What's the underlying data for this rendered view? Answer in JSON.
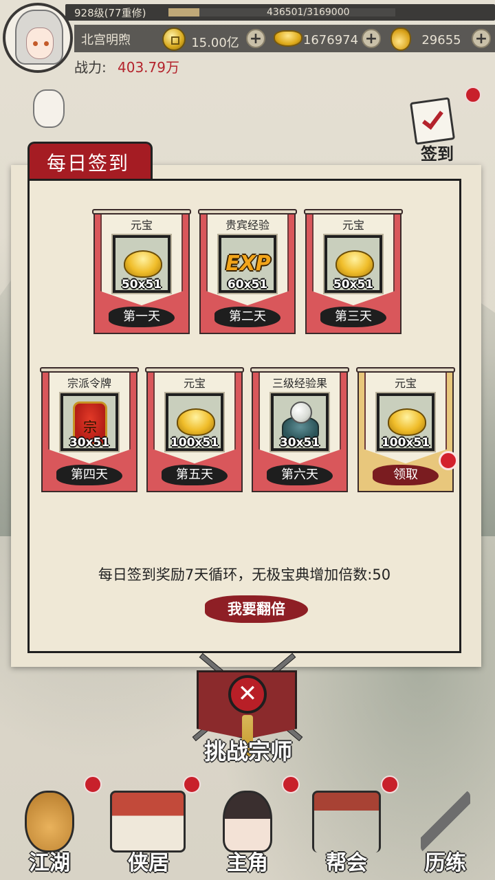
{
  "player": {
    "level_text": "928级(77重修)",
    "xp_text": "436501/3169000",
    "xp_progress": 0.1377,
    "name": "北宫明煦",
    "power_label": "战力:",
    "power_value": "403.79万"
  },
  "resources": [
    {
      "icon": "copper-coin-icon",
      "value": "15.00亿",
      "plus": "+"
    },
    {
      "icon": "gold-ingot-icon",
      "value": "1676974",
      "plus": "+"
    },
    {
      "icon": "gold-gourd-icon",
      "value": "29655",
      "plus": "+"
    }
  ],
  "side": {
    "signin_label": "签到"
  },
  "dialog": {
    "title": "每日签到",
    "rewards": [
      {
        "name": "元宝",
        "qty": "50x51",
        "day": "第一天",
        "icon": "gold-ingot-icon"
      },
      {
        "name": "贵宾经验",
        "qty": "60x51",
        "day": "第二天",
        "icon": "exp-icon"
      },
      {
        "name": "元宝",
        "qty": "50x51",
        "day": "第三天",
        "icon": "gold-ingot-icon"
      },
      {
        "name": "宗派令牌",
        "qty": "30x51",
        "day": "第四天",
        "icon": "sect-token-icon"
      },
      {
        "name": "元宝",
        "qty": "100x51",
        "day": "第五天",
        "icon": "gold-ingot-icon"
      },
      {
        "name": "三级经验果",
        "qty": "30x51",
        "day": "第六天",
        "icon": "exp-fruit-icon"
      },
      {
        "name": "元宝",
        "qty": "100x51",
        "day": "领取",
        "icon": "gold-ingot-icon"
      }
    ],
    "exp_icon_text": "EXP",
    "info": "每日签到奖励7天循环，无极宝典增加倍数:50",
    "double_button": "我要翻倍",
    "close_symbol": "✕"
  },
  "challenge": {
    "label": "挑战宗师"
  },
  "nav": [
    {
      "label": "江湖",
      "icon": "gourd-icon"
    },
    {
      "label": "侠居",
      "icon": "house-icon"
    },
    {
      "label": "主角",
      "icon": "hero-portrait-icon"
    },
    {
      "label": "帮会",
      "icon": "gate-icon"
    },
    {
      "label": "历练",
      "icon": "weapon-icon"
    }
  ],
  "colors": {
    "accent_red": "#a51c23",
    "paper": "#efe8d6",
    "banner_red": "#d9575b",
    "banner_gold": "#e8c77c"
  }
}
